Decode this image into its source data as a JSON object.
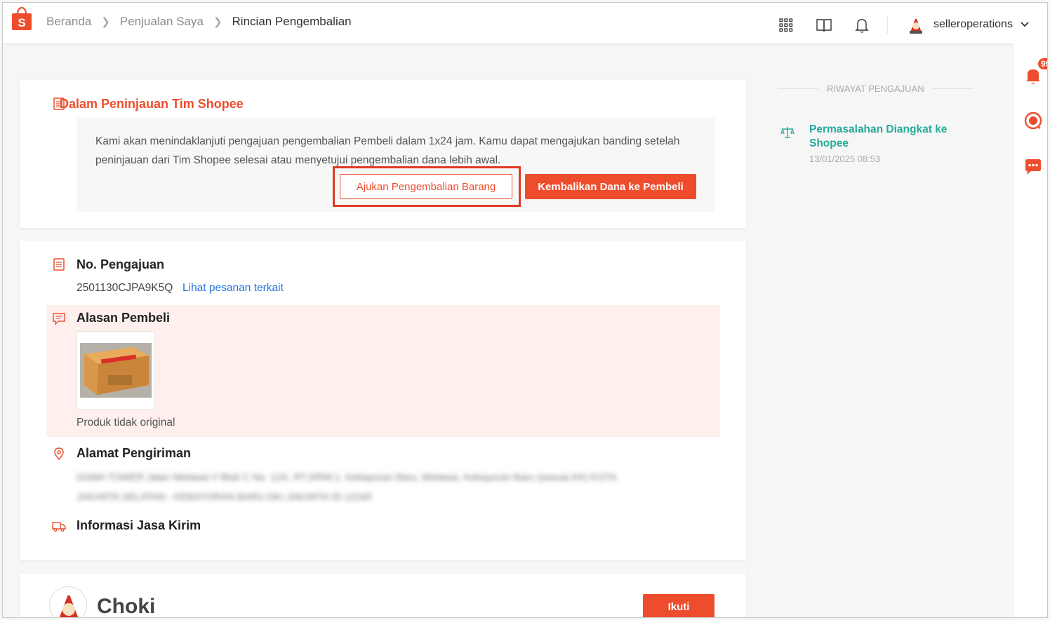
{
  "breadcrumb": {
    "home": "Beranda",
    "sales": "Penjualan Saya",
    "current": "Rincian Pengembalian"
  },
  "header": {
    "username": "selleroperations"
  },
  "rail": {
    "badge": "99+"
  },
  "status": {
    "title": "Dalam Peninjauan Tim Shopee",
    "text": "Kami akan menindaklanjuti pengajuan pengembalian Pembeli dalam 1x24 jam. Kamu dapat mengajukan banding setelah peninjauan dari Tim Shopee selesai atau menyetujui pengembalian dana lebih awal.",
    "btn_return": "Ajukan Pengembalian Barang",
    "btn_refund": "Kembalikan Dana ke Pembeli"
  },
  "request": {
    "label": "No. Pengajuan",
    "number": "2501130CJPA9K5Q",
    "link": "Lihat pesanan terkait"
  },
  "reason": {
    "label": "Alasan Pembeli",
    "text": "Produk tidak original"
  },
  "address": {
    "label": "Alamat Pengiriman",
    "line1": "GAMA TOWER Jalan Melawai V Blok C No. 12A, RT.3/RW.1, Kebayoran Baru, Melawai, Kebayoran Baru (sesuai KK) KOTA",
    "line2": "JAKARTA SELATAN - KEBAYORAN BARU DKI JAKARTA ID 12160"
  },
  "shipping": {
    "label": "Informasi Jasa Kirim"
  },
  "shop": {
    "name": "Choki",
    "follow": "Ikuti"
  },
  "history": {
    "title": "RIWAYAT PENGAJUAN",
    "item_title": "Permasalahan Diangkat ke Shopee",
    "item_date": "13/01/2025 08:53"
  },
  "colors": {
    "brand": "#ee4d2d",
    "link": "#2673dd",
    "history": "#26aa99"
  }
}
